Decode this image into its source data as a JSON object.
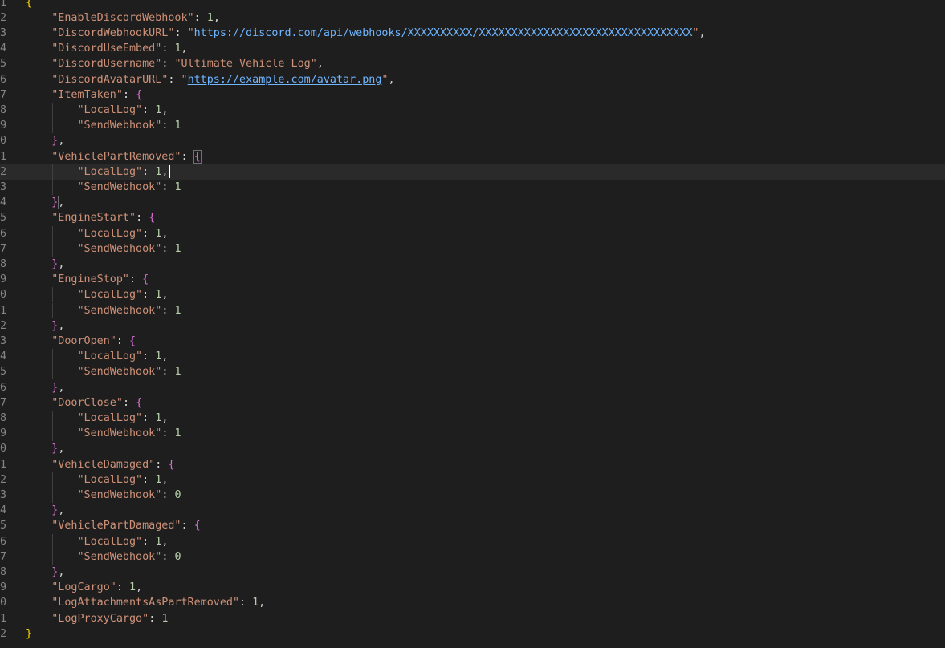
{
  "lines": [
    {
      "n": "1",
      "code": "{"
    },
    {
      "n": "2",
      "code": "    \"EnableDiscordWebhook\": 1,"
    },
    {
      "n": "3",
      "code": "    \"DiscordWebhookURL\": \"https://discord.com/api/webhooks/XXXXXXXXXX/XXXXXXXXXXXXXXXXXXXXXXXXXXXXXXXXX\","
    },
    {
      "n": "4",
      "code": "    \"DiscordUseEmbed\": 1,"
    },
    {
      "n": "5",
      "code": "    \"DiscordUsername\": \"Ultimate Vehicle Log\","
    },
    {
      "n": "6",
      "code": "    \"DiscordAvatarURL\": \"https://example.com/avatar.png\","
    },
    {
      "n": "7",
      "code": "    \"ItemTaken\": {"
    },
    {
      "n": "8",
      "code": "        \"LocalLog\": 1,"
    },
    {
      "n": "9",
      "code": "        \"SendWebhook\": 1"
    },
    {
      "n": "0",
      "code": "    },"
    },
    {
      "n": "1",
      "code": "    \"VehiclePartRemoved\": {"
    },
    {
      "n": "2",
      "code": "        \"LocalLog\": 1,"
    },
    {
      "n": "3",
      "code": "        \"SendWebhook\": 1"
    },
    {
      "n": "4",
      "code": "    },"
    },
    {
      "n": "5",
      "code": "    \"EngineStart\": {"
    },
    {
      "n": "6",
      "code": "        \"LocalLog\": 1,"
    },
    {
      "n": "7",
      "code": "        \"SendWebhook\": 1"
    },
    {
      "n": "8",
      "code": "    },"
    },
    {
      "n": "9",
      "code": "    \"EngineStop\": {"
    },
    {
      "n": "0",
      "code": "        \"LocalLog\": 1,"
    },
    {
      "n": "1",
      "code": "        \"SendWebhook\": 1"
    },
    {
      "n": "2",
      "code": "    },"
    },
    {
      "n": "3",
      "code": "    \"DoorOpen\": {"
    },
    {
      "n": "4",
      "code": "        \"LocalLog\": 1,"
    },
    {
      "n": "5",
      "code": "        \"SendWebhook\": 1"
    },
    {
      "n": "6",
      "code": "    },"
    },
    {
      "n": "7",
      "code": "    \"DoorClose\": {"
    },
    {
      "n": "8",
      "code": "        \"LocalLog\": 1,"
    },
    {
      "n": "9",
      "code": "        \"SendWebhook\": 1"
    },
    {
      "n": "0",
      "code": "    },"
    },
    {
      "n": "1",
      "code": "    \"VehicleDamaged\": {"
    },
    {
      "n": "2",
      "code": "        \"LocalLog\": 1,"
    },
    {
      "n": "3",
      "code": "        \"SendWebhook\": 0"
    },
    {
      "n": "4",
      "code": "    },"
    },
    {
      "n": "5",
      "code": "    \"VehiclePartDamaged\": {"
    },
    {
      "n": "6",
      "code": "        \"LocalLog\": 1,"
    },
    {
      "n": "7",
      "code": "        \"SendWebhook\": 0"
    },
    {
      "n": "8",
      "code": "    },"
    },
    {
      "n": "9",
      "code": "    \"LogCargo\": 1,"
    },
    {
      "n": "0",
      "code": "    \"LogAttachmentsAsPartRemoved\": 1,"
    },
    {
      "n": "1",
      "code": "    \"LogProxyCargo\": 1"
    },
    {
      "n": "2",
      "code": "}"
    }
  ],
  "current_line_index": 11,
  "colors": {
    "background": "#1e1e1e",
    "key_string": "#ce9178",
    "link": "#6fb5ff",
    "number": "#b5cea8",
    "brace_level1": "#ffd700",
    "brace_level2": "#da70d6"
  }
}
